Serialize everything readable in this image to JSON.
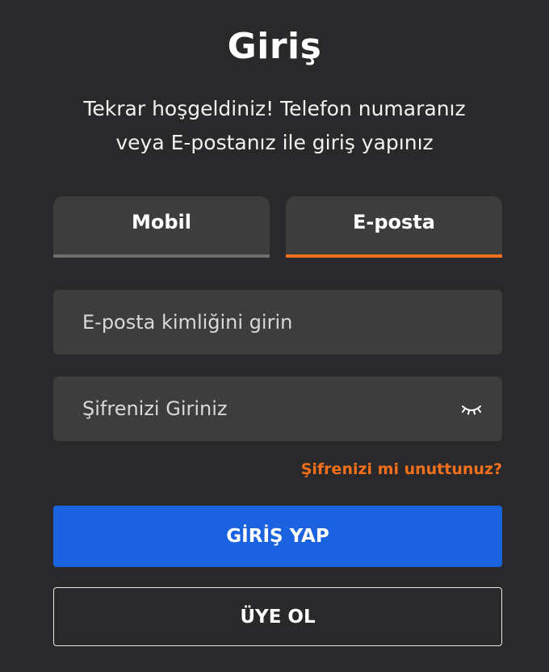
{
  "header": {
    "title": "Giriş",
    "subtitle_line1": "Tekrar hoşgeldiniz! Telefon numaranız",
    "subtitle_line2": "veya E-postanız ile giriş yapınız"
  },
  "tabs": [
    {
      "label": "Mobil",
      "active": false
    },
    {
      "label": "E-posta",
      "active": true
    }
  ],
  "form": {
    "email": {
      "value": "",
      "placeholder": "E-posta kimliğini girin"
    },
    "password": {
      "value": "",
      "placeholder": "Şifrenizi Giriniz",
      "icon": "eye-closed-icon"
    },
    "forgot_label": "Şifrenizi mi unuttunuz?"
  },
  "actions": {
    "login_label": "GİRİŞ YAP",
    "register_label": "ÜYE OL"
  },
  "colors": {
    "background": "#29282a",
    "field_bg": "#3d3d3e",
    "accent_orange": "#f2701c",
    "primary_blue": "#1a62df"
  }
}
